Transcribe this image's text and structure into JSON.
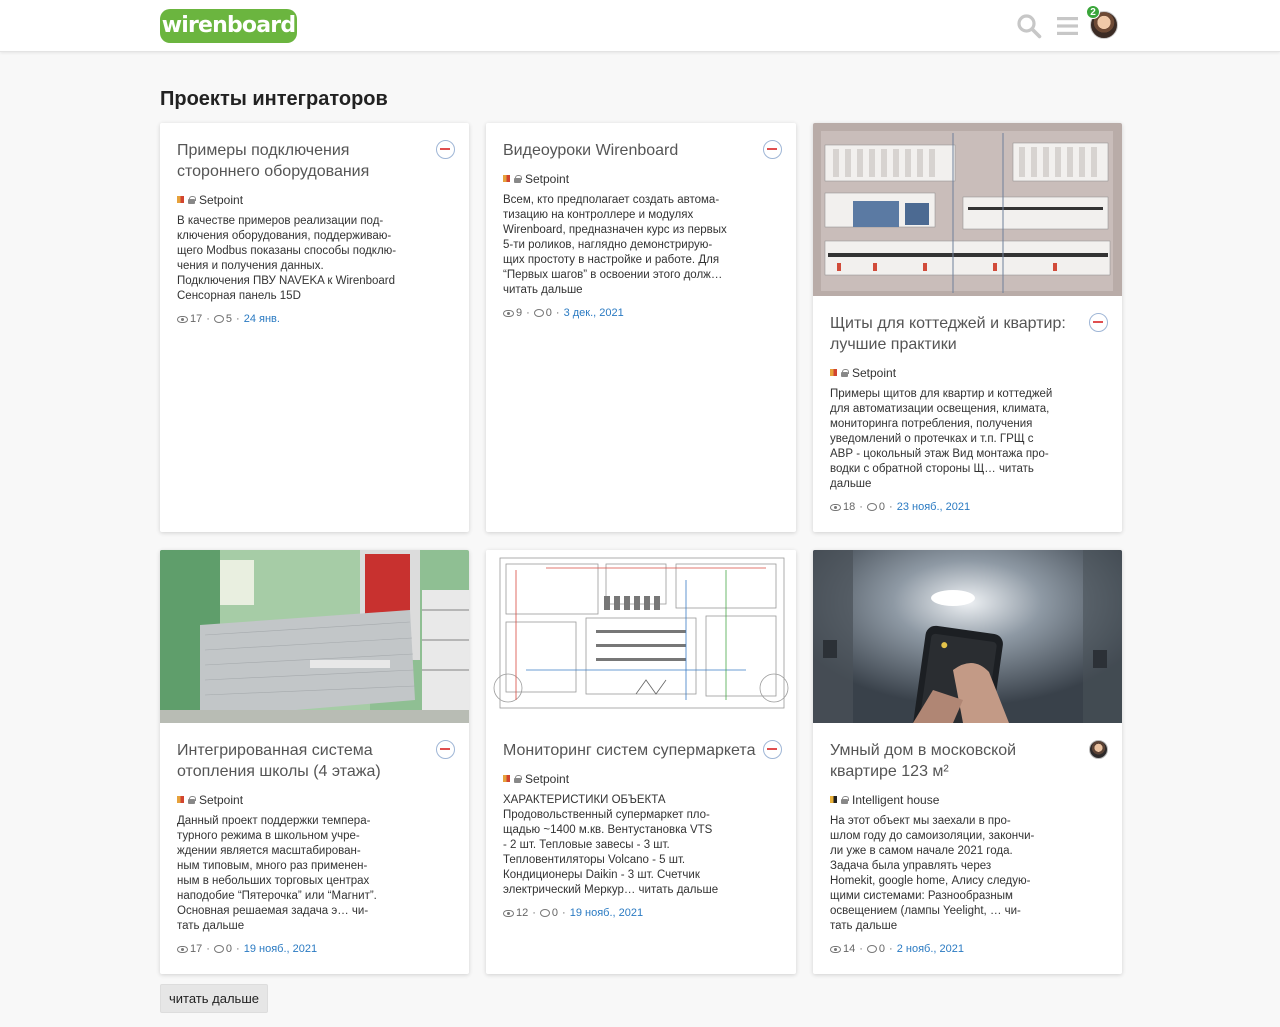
{
  "header": {
    "logo_text": "wirenboard",
    "notification_count": "2",
    "icons": [
      "search-icon",
      "menu-icon",
      "avatar"
    ]
  },
  "page": {
    "title": "Проекты интеграторов"
  },
  "cards": [
    {
      "title": "Примеры подключения стороннего оборудования",
      "category": "Setpoint",
      "excerpt": "В качестве примеров реализации под-\nключения оборудования, поддерживаю-\nщего Modbus показаны способы подклю-\nчения и получения данных.\nПодключения ПВУ NAVEKA к Wirenboard\nСенсорная панель 15D",
      "views": "17",
      "comments": "5",
      "date": "24 янв."
    },
    {
      "title": "Видеоуроки Wirenboard",
      "category": "Setpoint",
      "excerpt": "Всем, кто предполагает создать автома-\nтизацию на контроллере и модулях\nWirenboard, предназначен курс из первых\n5-ти роликов, наглядно демонстрирую-\nщих простоту в настройке и работе. Для\n“Первых шагов” в освоении этого долж…\nчитать дальше",
      "views": "9",
      "comments": "0",
      "date": "3 дек., 2021"
    },
    {
      "title": "Щиты для коттеджей и квартир: лучшие практики",
      "category": "Setpoint",
      "excerpt": "Примеры щитов для квартир и коттеджей\nдля автоматизации освещения, климата,\nмониторинга потребления, получения\nуведомлений о протечках и т.п. ГРЩ с\nАВР - цокольный этаж Вид монтажа про-\nводки с обратной стороны Щ… читать\nдальше",
      "views": "18",
      "comments": "0",
      "date": "23 нояб., 2021"
    },
    {
      "title": "Интегрированная система отопления школы (4 этажа)",
      "category": "Setpoint",
      "excerpt": "Данный проект поддержки темпера-\nтурного режима в школьном учре-\nждении является масштабирован-\nным типовым, много раз примен­ен-\nным в небольших торговых центрах\nнаподобие “Пятерочка” или “Магнит”.\nОсновная решаемая задача э… чи-\nтать дальше",
      "views": "17",
      "comments": "0",
      "date": "19 нояб., 2021"
    },
    {
      "title": "Мониторинг систем супермаркета",
      "category": "Setpoint",
      "excerpt": "ХАРАКТЕРИСТИКИ ОБЪЕКТА\nПродовольственный супермаркет пло-\nщадью ~1400 м.кв. Вентустановка VTS\n- 2 шт. Тепловые завесы - 3 шт.\nТепловентиляторы Volcano - 5 шт.\nКондиционеры Daikin - 3 шт. Счетчик\nэлектрический Меркур… читать дальше",
      "views": "12",
      "comments": "0",
      "date": "19 нояб., 2021"
    },
    {
      "title": "Умный дом в московской квартире 123 м²",
      "category": "Intelligent house",
      "excerpt": "На этот объект мы заехали в про-\nшлом году до самоизоляции, закончи-\nли уже в самом начале 2021 года.\nЗадача была управлять через\nHomekit, google home, Алису следую-\nщими системами: Разнообразным\nосвещением (лампы Yeelight, … чи-\nтать дальше",
      "views": "14",
      "comments": "0",
      "date": "2 нояб., 2021"
    }
  ],
  "load_more_label": "читать дальше",
  "colors": {
    "brand": "#6bb53f",
    "link": "#2a7ac2",
    "badge": "#3aa53a"
  }
}
